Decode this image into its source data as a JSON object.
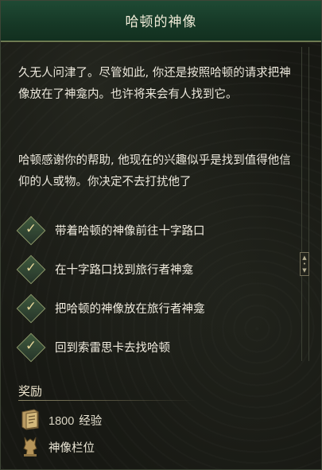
{
  "quest": {
    "title": "哈顿的神像",
    "paragraph1": "久无人问津了。尽管如此, 你还是按照哈顿的请求把神像放在了神龛内。也许将来会有人找到它。",
    "paragraph2": "哈顿感谢你的帮助, 他现在的兴趣似乎是找到值得他信仰的人或物。你决定不去打扰他了",
    "objectives": [
      {
        "label": "带着哈顿的神像前往十字路口",
        "completed": true
      },
      {
        "label": "在十字路口找到旅行者神龛",
        "completed": true
      },
      {
        "label": "把哈顿的神像放在旅行者神龛",
        "completed": true
      },
      {
        "label": "回到索雷思卡去找哈顿",
        "completed": true
      }
    ]
  },
  "rewards": {
    "title": "奖励",
    "items": [
      {
        "amount": "1800",
        "label": "经验",
        "icon": "tome-icon"
      },
      {
        "label": "神像栏位",
        "icon": "idol-icon"
      }
    ]
  },
  "icons": {
    "check": "✓"
  },
  "colors": {
    "header": "#1f4a34",
    "accent": "#6e7a52",
    "check_gold": "#e7d79a"
  }
}
